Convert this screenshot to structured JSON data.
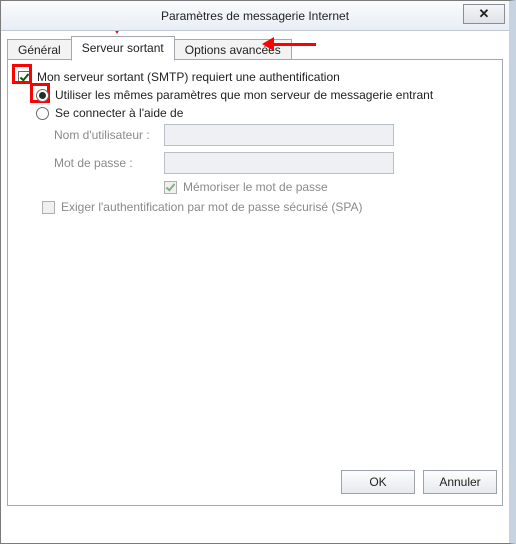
{
  "window": {
    "title": "Paramètres de messagerie Internet",
    "close": "✕"
  },
  "tabs": {
    "general": "Général",
    "outgoing": "Serveur sortant",
    "advanced": "Options avancées"
  },
  "form": {
    "smtp_auth": "Mon serveur sortant (SMTP) requiert une authentification",
    "same_settings": "Utiliser les mêmes paramètres que mon serveur de messagerie entrant",
    "logon_using": "Se connecter à l'aide de",
    "username_label": "Nom d'utilisateur :",
    "password_label": "Mot de passe :",
    "remember_password": "Mémoriser le mot de passe",
    "require_spa": "Exiger l'authentification par mot de passe sécurisé (SPA)"
  },
  "buttons": {
    "ok": "OK",
    "cancel": "Annuler"
  }
}
